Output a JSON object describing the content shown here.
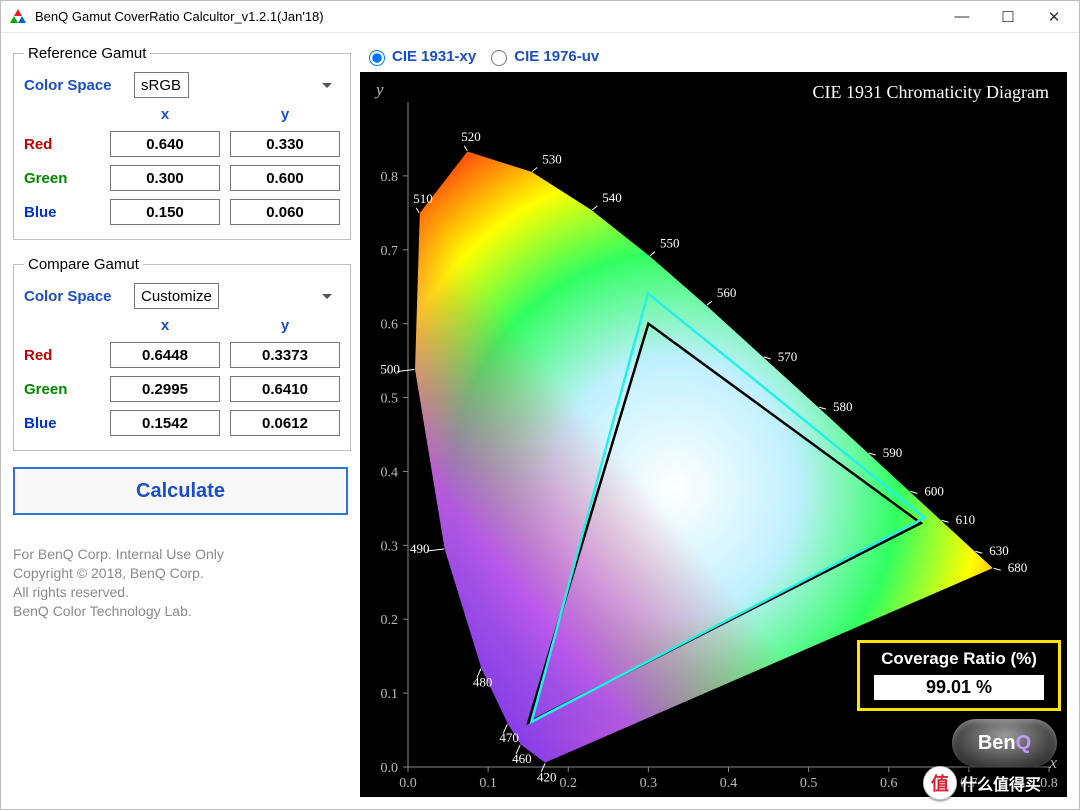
{
  "window": {
    "title": "BenQ Gamut CoverRatio Calcultor_v1.2.1(Jan'18)",
    "minimize": "—",
    "maximize": "☐",
    "close": "✕"
  },
  "reference": {
    "legend": "Reference Gamut",
    "cs_label": "Color Space",
    "cs_value": "sRGB",
    "head_x": "x",
    "head_y": "y",
    "rows": [
      {
        "label": "Red",
        "x": "0.640",
        "y": "0.330"
      },
      {
        "label": "Green",
        "x": "0.300",
        "y": "0.600"
      },
      {
        "label": "Blue",
        "x": "0.150",
        "y": "0.060"
      }
    ]
  },
  "compare": {
    "legend": "Compare Gamut",
    "cs_label": "Color Space",
    "cs_value": "Customize",
    "head_x": "x",
    "head_y": "y",
    "rows": [
      {
        "label": "Red",
        "x": "0.6448",
        "y": "0.3373"
      },
      {
        "label": "Green",
        "x": "0.2995",
        "y": "0.6410"
      },
      {
        "label": "Blue",
        "x": "0.1542",
        "y": "0.0612"
      }
    ]
  },
  "calculate_label": "Calculate",
  "footer": {
    "l1": "For BenQ Corp. Internal Use Only",
    "l2": "Copyright ©  2018, BenQ Corp.",
    "l3": "All rights reserved.",
    "l4": "BenQ Color Technology Lab."
  },
  "radios": {
    "opt1": "CIE 1931-xy",
    "opt2": "CIE 1976-uv",
    "selected": "opt1"
  },
  "diagram": {
    "title": "CIE 1931 Chromaticity Diagram",
    "xaxis": "x",
    "yaxis": "y",
    "coverage_title": "Coverage Ratio (%)",
    "coverage_value": "99.01 %",
    "brand": "Ben",
    "brand_q": "Q"
  },
  "watermark": {
    "char": "值",
    "text": "什么值得买"
  },
  "chart_data": {
    "type": "other",
    "description": "CIE 1931 xy chromaticity diagram with spectral locus wavelength labels and two triangle gamuts (reference sRGB in black, compare gamut in cyan).",
    "xlim": [
      0.0,
      0.8
    ],
    "ylim": [
      0.0,
      0.9
    ],
    "xticks": [
      0.0,
      0.1,
      0.2,
      0.3,
      0.4,
      0.5,
      0.6,
      0.7,
      0.8
    ],
    "yticks": [
      0.0,
      0.1,
      0.2,
      0.3,
      0.4,
      0.5,
      0.6,
      0.7,
      0.8
    ],
    "locus_labels_nm": [
      420,
      460,
      470,
      480,
      490,
      500,
      510,
      520,
      530,
      540,
      550,
      560,
      570,
      580,
      590,
      600,
      610,
      630,
      680
    ],
    "series": [
      {
        "name": "Reference sRGB",
        "color": "#000000",
        "points": [
          [
            0.64,
            0.33
          ],
          [
            0.3,
            0.6
          ],
          [
            0.15,
            0.06
          ]
        ]
      },
      {
        "name": "Compare",
        "color": "#25f0e8",
        "points": [
          [
            0.6448,
            0.3373
          ],
          [
            0.2995,
            0.641
          ],
          [
            0.1542,
            0.0612
          ]
        ]
      }
    ],
    "coverage_ratio_percent": 99.01
  }
}
